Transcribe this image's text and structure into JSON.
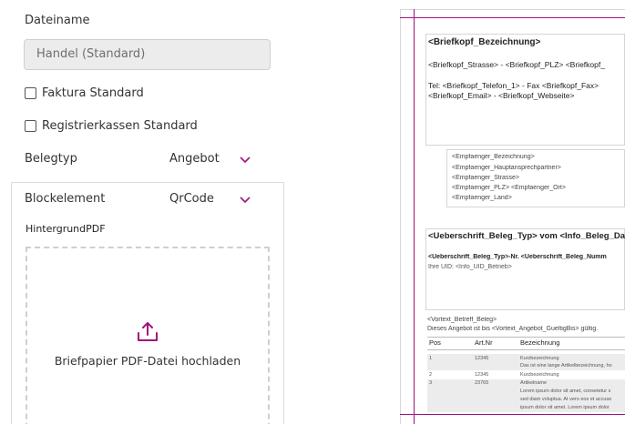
{
  "form": {
    "dateiname_label": "Dateiname",
    "dateiname_value": "Handel (Standard)",
    "faktura_label": "Faktura Standard",
    "registrier_label": "Registrierkassen Standard",
    "belegtyp_label": "Belegtyp",
    "belegtyp_value": "Angebot",
    "blockelement_label": "Blockelement",
    "blockelement_value": "QrCode",
    "hintergrund_label": "HintergrundPDF",
    "upload_text": "Briefpapier PDF-Datei hochladen",
    "accent_color": "#a0127c"
  },
  "preview": {
    "kopf_title": "<Briefkopf_Bezeichnung>",
    "kopf_line1": "<Briefkopf_Strasse> - <Briefkopf_PLZ> <Briefkopf_",
    "kopf_line2": "Tel: <Briefkopf_Telefon_1> - Fax <Briefkopf_Fax>",
    "kopf_line3": "<Briefkopf_Email> - <Briefkopf_Webseite>",
    "empf": [
      "<Empfaenger_Bezeichnung>",
      "<Empfaenger_Hauptansprechpartner>",
      "<Empfaenger_Strasse>",
      "<Empfaenger_PLZ> <Empfaenger_Ort>",
      "<Empfaenger_Land>"
    ],
    "ueber_title": "<Ueberschrift_Beleg_Typ> vom <Info_Beleg_Da",
    "ueber_line1": "<Ueberschrift_Beleg_Typ>-Nr. <Ueberschrift_Beleg_Numm",
    "ueber_line2": "Ihre UID: <Info_UID_Betrieb>",
    "vortext_line1": "<Vortext_Betreff_Beleg>",
    "vortext_line2": "Dieses Angebot ist bis <Vortext_Angebot_GueltigBis> gültig.",
    "table_headers": [
      "Pos",
      "Art.Nr",
      "Bezeichnung"
    ],
    "rows": [
      {
        "pos": "1",
        "art": "12345",
        "lines": [
          "Kurzbezeichnung",
          "Das ist eine lange Artikelbezeichnung, ho"
        ]
      },
      {
        "pos": "2",
        "art": "12345",
        "lines": [
          "Kurzbezeichnung"
        ]
      },
      {
        "pos": "3",
        "art": "23765",
        "lines": [
          "Artikelname",
          "Lorem ipsum dolor sit amet, consetetur s",
          "sed diam voluptua. At vero eos et accuse",
          "ipsum dolor sit amet. Lorem ipsum dolor"
        ]
      }
    ]
  }
}
